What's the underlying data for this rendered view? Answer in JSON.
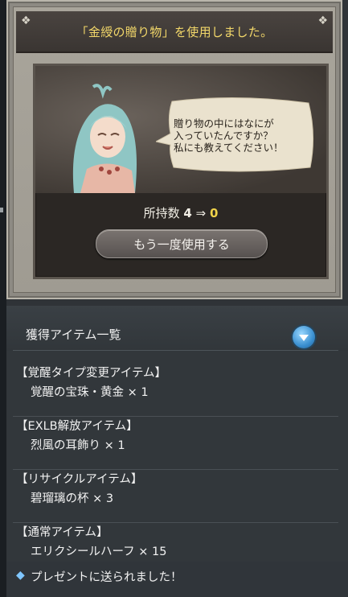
{
  "dialog": {
    "title": "「金綬の贈り物」を使用しました。",
    "speech": [
      "贈り物の中にはなにが",
      "入っていたんですか？",
      "私にも教えてください！"
    ],
    "count_label": "所持数",
    "count_old": "4",
    "arrow": "⇒",
    "count_new": "0",
    "use_again_label": "もう一度使用する"
  },
  "list": {
    "header": "獲得アイテム一覧",
    "items": [
      {
        "category": "【覚醒タイプ変更アイテム】",
        "name": "覚醒の宝珠・黄金 × 1"
      },
      {
        "category": "【EXLB解放アイテム】",
        "name": "烈風の耳飾り × 1"
      },
      {
        "category": "【リサイクルアイテム】",
        "name": "碧瑠璃の杯 × 3"
      },
      {
        "category": "【通常アイテム】",
        "name": "エリクシールハーフ × 15"
      }
    ],
    "footer_icon": "diamond-icon",
    "footer": "プレゼントに送られました！"
  },
  "colors": {
    "title_gold": "#f3d86a",
    "count_new": "#f0d34a",
    "accent_blue": "#3a8fd0"
  }
}
